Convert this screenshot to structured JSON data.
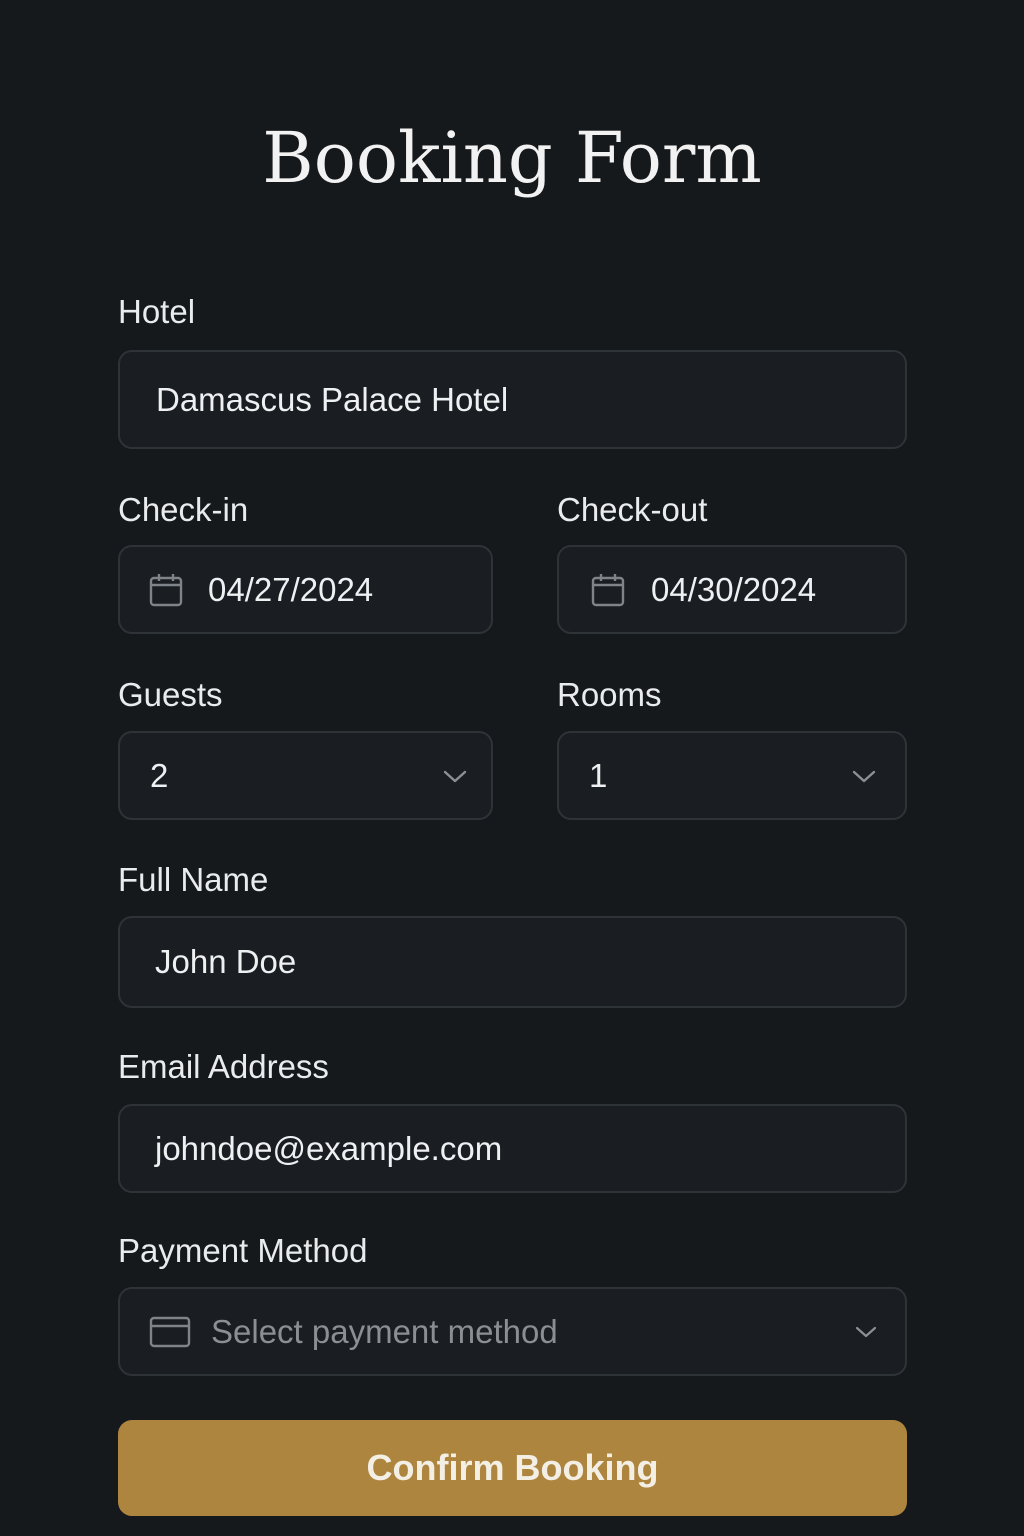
{
  "form": {
    "title": "Booking Form",
    "hotel": {
      "label": "Hotel",
      "value": "Damascus Palace Hotel"
    },
    "check_in": {
      "label": "Check-in",
      "value": "04/27/2024",
      "icon": "calendar-icon"
    },
    "check_out": {
      "label": "Check-out",
      "value": "04/30/2024",
      "icon": "calendar-icon"
    },
    "guests": {
      "label": "Guests",
      "value": "2",
      "icon": "chevron-down-icon"
    },
    "rooms": {
      "label": "Rooms",
      "value": "1",
      "icon": "chevron-down-icon"
    },
    "full_name": {
      "label": "Full Name",
      "value": "John Doe"
    },
    "email": {
      "label": "Email Address",
      "value": "johndoe@example.com"
    },
    "payment": {
      "label": "Payment Method",
      "placeholder": "Select payment method",
      "icon": "credit-card-icon"
    },
    "submit_label": "Confirm Booking"
  },
  "colors": {
    "background": "#16191c",
    "field_background": "#1a1d21",
    "field_border": "#2e3338",
    "accent": "#ad853f"
  }
}
